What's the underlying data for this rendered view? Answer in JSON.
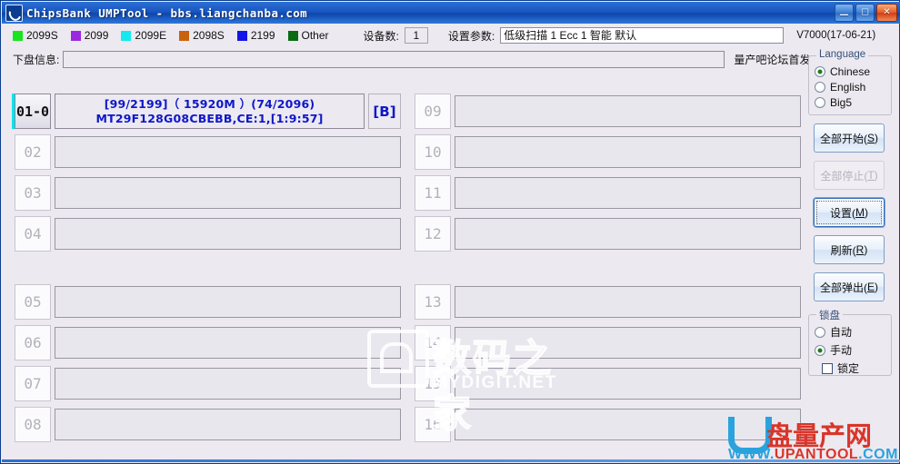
{
  "window": {
    "title": "ChipsBank UMPTool - bbs.liangchanba.com",
    "icon": "moon-icon",
    "minimize_label": "—",
    "maximize_label": "□",
    "close_label": "✕"
  },
  "legend": {
    "items": [
      {
        "label": "2099S",
        "color": "#19e51e"
      },
      {
        "label": "2099",
        "color": "#9b29e0"
      },
      {
        "label": "2099E",
        "color": "#16e8f0"
      },
      {
        "label": "2098S",
        "color": "#c9620c"
      },
      {
        "label": "2199",
        "color": "#1414e8"
      },
      {
        "label": "Other",
        "color": "#0a6b12"
      }
    ]
  },
  "toolbar": {
    "device_count_label": "设备数:",
    "device_count_value": "1",
    "param_label": "设置参数:",
    "param_value": "低级扫描 1 Ecc 1 智能 默认",
    "version": "V7000(17-06-21)"
  },
  "diskinfo": {
    "label": "下盘信息:",
    "value": "",
    "forum_text": "量产吧论坛首发"
  },
  "slots": {
    "left": [
      {
        "num": "01-0",
        "active": true,
        "line1": "[99/2199]（ 15920M ）(74/2096)",
        "line2": "MT29F128G08CBEBB,CE:1,[1:9:57]",
        "badge": "[B]"
      },
      {
        "num": "02",
        "active": false,
        "line1": "",
        "line2": "",
        "badge": ""
      },
      {
        "num": "03",
        "active": false,
        "line1": "",
        "line2": "",
        "badge": ""
      },
      {
        "num": "04",
        "active": false,
        "line1": "",
        "line2": "",
        "badge": ""
      },
      {
        "num": "05",
        "active": false,
        "line1": "",
        "line2": "",
        "badge": ""
      },
      {
        "num": "06",
        "active": false,
        "line1": "",
        "line2": "",
        "badge": ""
      },
      {
        "num": "07",
        "active": false,
        "line1": "",
        "line2": "",
        "badge": ""
      },
      {
        "num": "08",
        "active": false,
        "line1": "",
        "line2": "",
        "badge": ""
      }
    ],
    "right": [
      {
        "num": "09",
        "active": false,
        "line1": "",
        "line2": "",
        "badge": ""
      },
      {
        "num": "10",
        "active": false,
        "line1": "",
        "line2": "",
        "badge": ""
      },
      {
        "num": "11",
        "active": false,
        "line1": "",
        "line2": "",
        "badge": ""
      },
      {
        "num": "12",
        "active": false,
        "line1": "",
        "line2": "",
        "badge": ""
      },
      {
        "num": "13",
        "active": false,
        "line1": "",
        "line2": "",
        "badge": ""
      },
      {
        "num": "14",
        "active": false,
        "line1": "",
        "line2": "",
        "badge": ""
      },
      {
        "num": "15",
        "active": false,
        "line1": "",
        "line2": "",
        "badge": ""
      },
      {
        "num": "16",
        "active": false,
        "line1": "",
        "line2": "",
        "badge": ""
      }
    ]
  },
  "panel": {
    "language": {
      "title": "Language",
      "options": [
        {
          "label": "Chinese",
          "selected": true
        },
        {
          "label": "English",
          "selected": false
        },
        {
          "label": "Big5",
          "selected": false
        }
      ]
    },
    "buttons": [
      {
        "text": "全部开始(",
        "accel": "S",
        "tail": ")",
        "state": "normal"
      },
      {
        "text": "全部停止(",
        "accel": "T",
        "tail": ")",
        "state": "disabled"
      },
      {
        "text": "设置(",
        "accel": "M",
        "tail": ")",
        "state": "focused"
      },
      {
        "text": "刷新(",
        "accel": "R",
        "tail": ")",
        "state": "normal"
      },
      {
        "text": "全部弹出(",
        "accel": "E",
        "tail": ")",
        "state": "normal"
      }
    ],
    "lock": {
      "title": "锁盘",
      "options": [
        {
          "label": "自动",
          "selected": false
        },
        {
          "label": "手动",
          "selected": true
        }
      ],
      "checkbox_label": "锁定",
      "checkbox_checked": false
    }
  },
  "watermarks": {
    "mydigit_cn": "数码之家",
    "mydigit_en": "MYDIGIT.NET",
    "logo_cn": "盘量产网",
    "logo_www": "WWW.",
    "logo_name": "UPANTOOL",
    "logo_com": ".COM"
  }
}
